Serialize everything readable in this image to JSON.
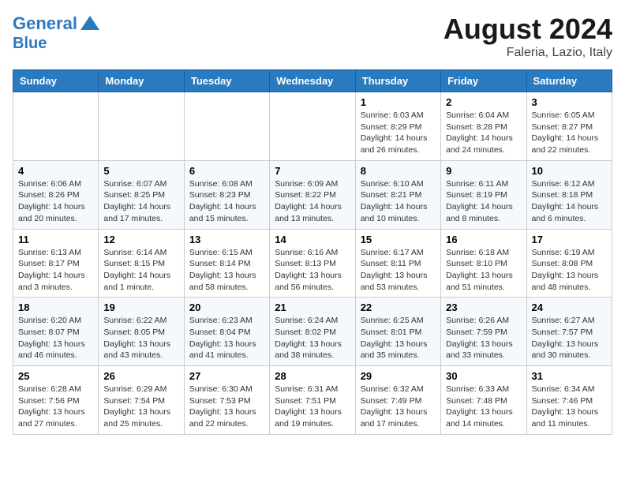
{
  "header": {
    "logo_line1": "General",
    "logo_line2": "Blue",
    "month_year": "August 2024",
    "location": "Faleria, Lazio, Italy"
  },
  "days_of_week": [
    "Sunday",
    "Monday",
    "Tuesday",
    "Wednesday",
    "Thursday",
    "Friday",
    "Saturday"
  ],
  "weeks": [
    [
      {
        "day": "",
        "info": ""
      },
      {
        "day": "",
        "info": ""
      },
      {
        "day": "",
        "info": ""
      },
      {
        "day": "",
        "info": ""
      },
      {
        "day": "1",
        "info": "Sunrise: 6:03 AM\nSunset: 8:29 PM\nDaylight: 14 hours and 26 minutes."
      },
      {
        "day": "2",
        "info": "Sunrise: 6:04 AM\nSunset: 8:28 PM\nDaylight: 14 hours and 24 minutes."
      },
      {
        "day": "3",
        "info": "Sunrise: 6:05 AM\nSunset: 8:27 PM\nDaylight: 14 hours and 22 minutes."
      }
    ],
    [
      {
        "day": "4",
        "info": "Sunrise: 6:06 AM\nSunset: 8:26 PM\nDaylight: 14 hours and 20 minutes."
      },
      {
        "day": "5",
        "info": "Sunrise: 6:07 AM\nSunset: 8:25 PM\nDaylight: 14 hours and 17 minutes."
      },
      {
        "day": "6",
        "info": "Sunrise: 6:08 AM\nSunset: 8:23 PM\nDaylight: 14 hours and 15 minutes."
      },
      {
        "day": "7",
        "info": "Sunrise: 6:09 AM\nSunset: 8:22 PM\nDaylight: 14 hours and 13 minutes."
      },
      {
        "day": "8",
        "info": "Sunrise: 6:10 AM\nSunset: 8:21 PM\nDaylight: 14 hours and 10 minutes."
      },
      {
        "day": "9",
        "info": "Sunrise: 6:11 AM\nSunset: 8:19 PM\nDaylight: 14 hours and 8 minutes."
      },
      {
        "day": "10",
        "info": "Sunrise: 6:12 AM\nSunset: 8:18 PM\nDaylight: 14 hours and 6 minutes."
      }
    ],
    [
      {
        "day": "11",
        "info": "Sunrise: 6:13 AM\nSunset: 8:17 PM\nDaylight: 14 hours and 3 minutes."
      },
      {
        "day": "12",
        "info": "Sunrise: 6:14 AM\nSunset: 8:15 PM\nDaylight: 14 hours and 1 minute."
      },
      {
        "day": "13",
        "info": "Sunrise: 6:15 AM\nSunset: 8:14 PM\nDaylight: 13 hours and 58 minutes."
      },
      {
        "day": "14",
        "info": "Sunrise: 6:16 AM\nSunset: 8:13 PM\nDaylight: 13 hours and 56 minutes."
      },
      {
        "day": "15",
        "info": "Sunrise: 6:17 AM\nSunset: 8:11 PM\nDaylight: 13 hours and 53 minutes."
      },
      {
        "day": "16",
        "info": "Sunrise: 6:18 AM\nSunset: 8:10 PM\nDaylight: 13 hours and 51 minutes."
      },
      {
        "day": "17",
        "info": "Sunrise: 6:19 AM\nSunset: 8:08 PM\nDaylight: 13 hours and 48 minutes."
      }
    ],
    [
      {
        "day": "18",
        "info": "Sunrise: 6:20 AM\nSunset: 8:07 PM\nDaylight: 13 hours and 46 minutes."
      },
      {
        "day": "19",
        "info": "Sunrise: 6:22 AM\nSunset: 8:05 PM\nDaylight: 13 hours and 43 minutes."
      },
      {
        "day": "20",
        "info": "Sunrise: 6:23 AM\nSunset: 8:04 PM\nDaylight: 13 hours and 41 minutes."
      },
      {
        "day": "21",
        "info": "Sunrise: 6:24 AM\nSunset: 8:02 PM\nDaylight: 13 hours and 38 minutes."
      },
      {
        "day": "22",
        "info": "Sunrise: 6:25 AM\nSunset: 8:01 PM\nDaylight: 13 hours and 35 minutes."
      },
      {
        "day": "23",
        "info": "Sunrise: 6:26 AM\nSunset: 7:59 PM\nDaylight: 13 hours and 33 minutes."
      },
      {
        "day": "24",
        "info": "Sunrise: 6:27 AM\nSunset: 7:57 PM\nDaylight: 13 hours and 30 minutes."
      }
    ],
    [
      {
        "day": "25",
        "info": "Sunrise: 6:28 AM\nSunset: 7:56 PM\nDaylight: 13 hours and 27 minutes."
      },
      {
        "day": "26",
        "info": "Sunrise: 6:29 AM\nSunset: 7:54 PM\nDaylight: 13 hours and 25 minutes."
      },
      {
        "day": "27",
        "info": "Sunrise: 6:30 AM\nSunset: 7:53 PM\nDaylight: 13 hours and 22 minutes."
      },
      {
        "day": "28",
        "info": "Sunrise: 6:31 AM\nSunset: 7:51 PM\nDaylight: 13 hours and 19 minutes."
      },
      {
        "day": "29",
        "info": "Sunrise: 6:32 AM\nSunset: 7:49 PM\nDaylight: 13 hours and 17 minutes."
      },
      {
        "day": "30",
        "info": "Sunrise: 6:33 AM\nSunset: 7:48 PM\nDaylight: 13 hours and 14 minutes."
      },
      {
        "day": "31",
        "info": "Sunrise: 6:34 AM\nSunset: 7:46 PM\nDaylight: 13 hours and 11 minutes."
      }
    ]
  ]
}
